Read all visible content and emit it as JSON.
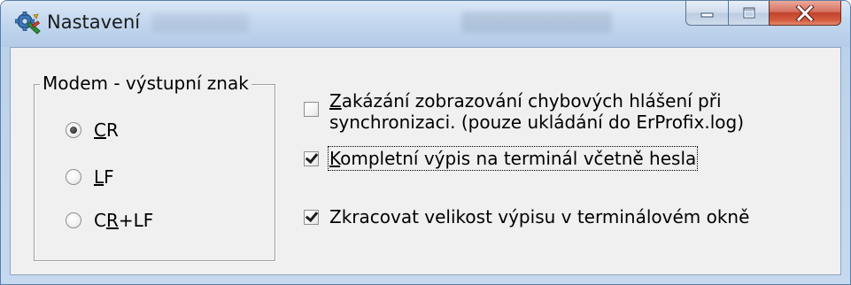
{
  "window": {
    "title": "Nastavení",
    "app_icon": "gear-wrench-icon",
    "caption_buttons": [
      "minimize-icon",
      "maximize-icon",
      "close-icon"
    ],
    "close_color": "#c6402b"
  },
  "modem_group": {
    "title": "Modem - výstupní znak",
    "options": [
      {
        "pre": "",
        "mnemonic": "C",
        "post": "R",
        "checked": true
      },
      {
        "pre": "",
        "mnemonic": "L",
        "post": "F",
        "checked": false
      },
      {
        "pre": "C",
        "mnemonic": "R",
        "post": "+LF",
        "checked": false
      }
    ]
  },
  "options": {
    "disable_errors": {
      "mnemonic": "Z",
      "line1": "akázání zobrazování chybových hlášení při",
      "line2": "synchronizaci. (pouze ukládání do ErProfix.log)",
      "checked": false
    },
    "full_output": {
      "mnemonic": "K",
      "rest": "ompletní výpis na terminál včetně hesla",
      "checked": true
    },
    "shorten_output": {
      "label": "Zkracovat velikost výpisu v terminálovém okně",
      "checked": true
    }
  }
}
